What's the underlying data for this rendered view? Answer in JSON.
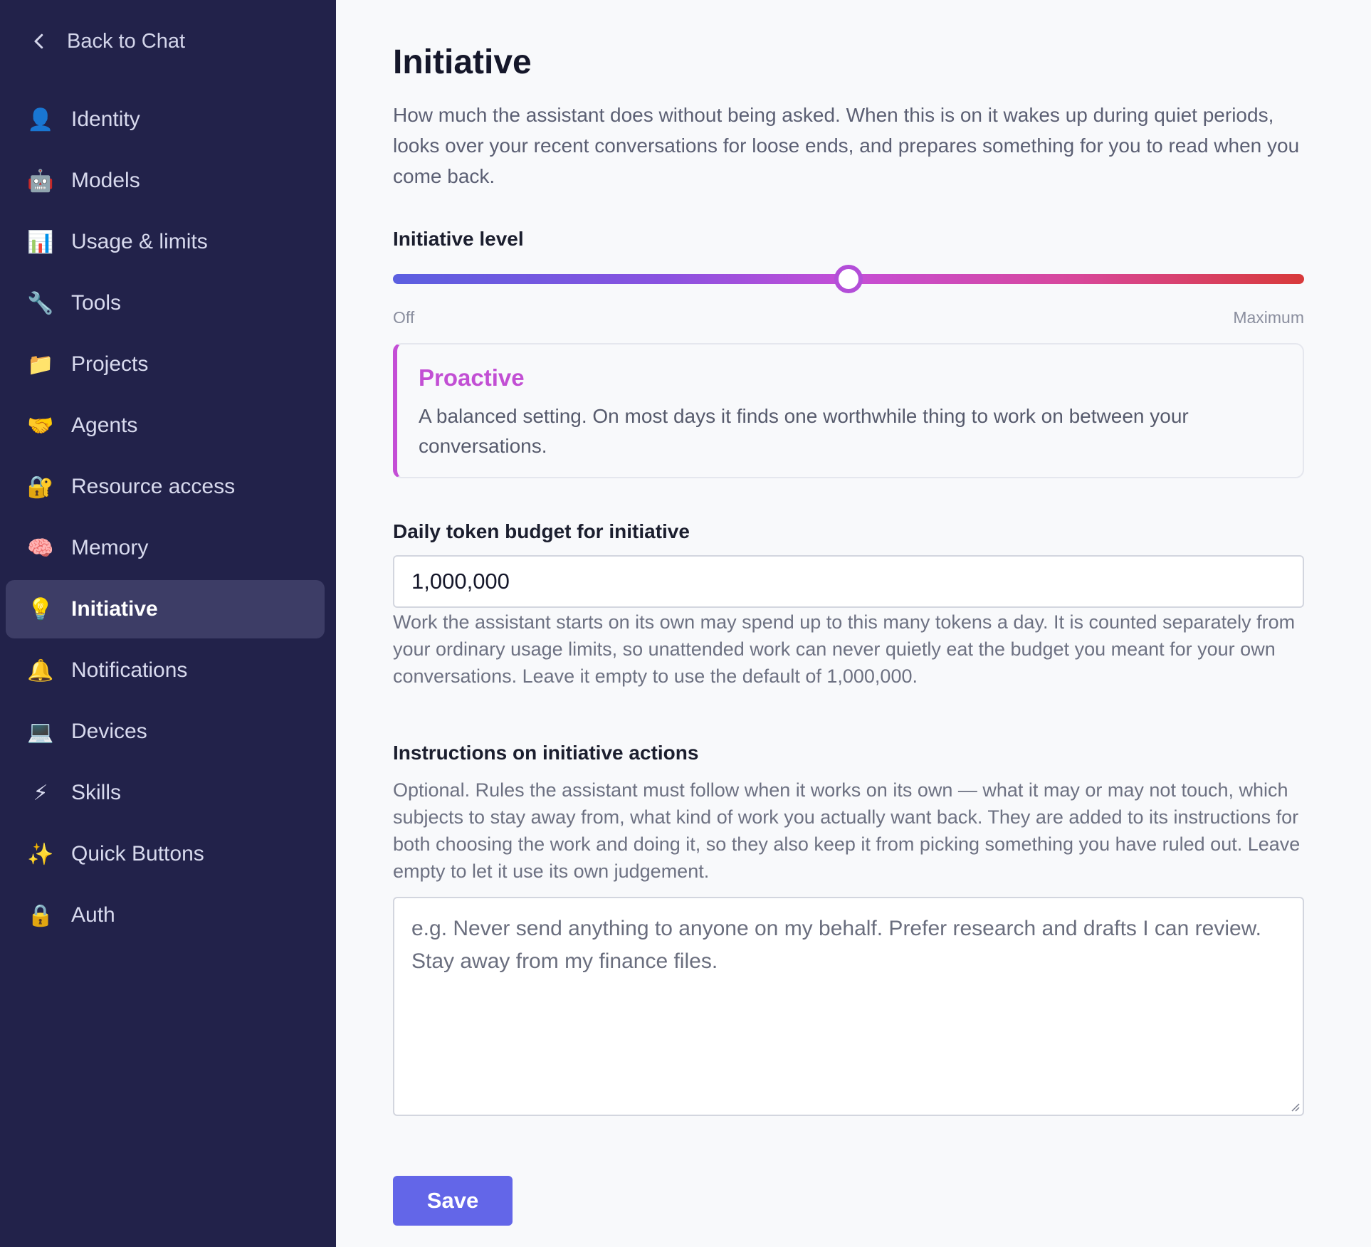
{
  "sidebar": {
    "back_label": "Back to Chat",
    "active": "Initiative",
    "items": [
      {
        "label": "Identity",
        "icon": "👤",
        "icon_name": "user-icon"
      },
      {
        "label": "Models",
        "icon": "🤖",
        "icon_name": "robot-icon"
      },
      {
        "label": "Usage & limits",
        "icon": "📊",
        "icon_name": "bar-chart-icon"
      },
      {
        "label": "Tools",
        "icon": "🔧",
        "icon_name": "wrench-icon"
      },
      {
        "label": "Projects",
        "icon": "📁",
        "icon_name": "folder-icon"
      },
      {
        "label": "Agents",
        "icon": "🤝",
        "icon_name": "handshake-icon"
      },
      {
        "label": "Resource access",
        "icon": "🔐",
        "icon_name": "lock-key-icon"
      },
      {
        "label": "Memory",
        "icon": "🧠",
        "icon_name": "brain-icon"
      },
      {
        "label": "Initiative",
        "icon": "💡",
        "icon_name": "lightbulb-icon"
      },
      {
        "label": "Notifications",
        "icon": "🔔",
        "icon_name": "bell-icon"
      },
      {
        "label": "Devices",
        "icon": "💻",
        "icon_name": "laptop-icon"
      },
      {
        "label": "Skills",
        "icon": "⚡",
        "icon_name": "lightning-icon"
      },
      {
        "label": "Quick Buttons",
        "icon": "✨",
        "icon_name": "sparkles-icon"
      },
      {
        "label": "Auth",
        "icon": "🔒",
        "icon_name": "lock-icon"
      }
    ]
  },
  "page": {
    "title": "Initiative",
    "description": "How much the assistant does without being asked. When this is on it wakes up during quiet periods, looks over your recent conversations for loose ends, and prepares something for you to read when you come back."
  },
  "initiative_level": {
    "label": "Initiative level",
    "min_label": "Off",
    "max_label": "Maximum",
    "value_fraction": 0.5,
    "current_name": "Proactive",
    "current_description": "A balanced setting. On most days it finds one worthwhile thing to work on between your conversations.",
    "accent_color": "#c44ed6"
  },
  "token_budget": {
    "label": "Daily token budget for initiative",
    "value": "1,000,000",
    "help": "Work the assistant starts on its own may spend up to this many tokens a day. It is counted separately from your ordinary usage limits, so unattended work can never quietly eat the budget you meant for your own conversations. Leave it empty to use the default of 1,000,000."
  },
  "instructions": {
    "label": "Instructions on initiative actions",
    "help": "Optional. Rules the assistant must follow when it works on its own — what it may or may not touch, which subjects to stay away from, what kind of work you actually want back. They are added to its instructions for both choosing the work and doing it, so they also keep it from picking something you have ruled out. Leave empty to let it use its own judgement.",
    "placeholder": "e.g. Never send anything to anyone on my behalf. Prefer research and drafts I can review. Stay away from my finance files.",
    "value": ""
  },
  "save_label": "Save",
  "colors": {
    "sidebar_bg": "#22224a",
    "active_item_bg": "#3d3d66",
    "primary_button": "#6366e8"
  }
}
